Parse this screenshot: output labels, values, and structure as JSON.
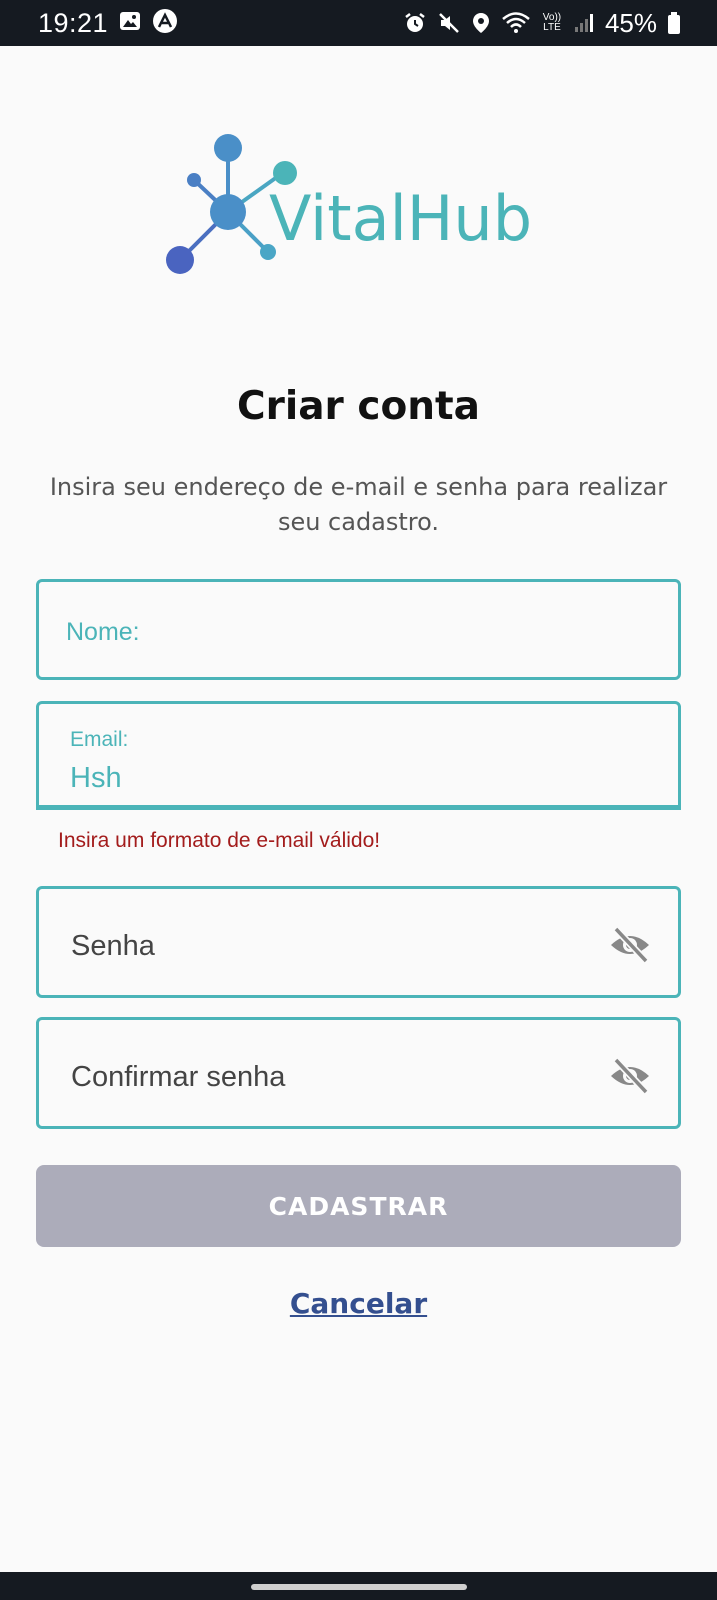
{
  "status_bar": {
    "time": "19:21",
    "battery": "45%",
    "left_icons": [
      "image-icon",
      "app-icon"
    ],
    "right_icons": [
      "alarm-icon",
      "mute-icon",
      "location-icon",
      "wifi-icon",
      "volte-icon",
      "signal-icon",
      "battery-icon"
    ],
    "volte_text": "Vo)) LTE"
  },
  "logo": {
    "text": "VitalHub",
    "colors": {
      "primary": "#4bb4b8",
      "secondary": "#4a77c4"
    }
  },
  "form": {
    "title": "Criar conta",
    "subtitle": "Insira seu endereço de e-mail e senha para realizar seu cadastro.",
    "name_placeholder": "Nome:",
    "email_label": "Email:",
    "email_value": "Hsh",
    "email_error": "Insira um formato de e-mail válido!",
    "password_placeholder": "Senha",
    "confirm_password_placeholder": "Confirmar senha",
    "submit_label": "CADASTRAR",
    "cancel_label": "Cancelar"
  },
  "colors": {
    "accent": "#4bb4b8",
    "error": "#a31c1c",
    "button_disabled": "#acacba",
    "link": "#344f8f"
  }
}
